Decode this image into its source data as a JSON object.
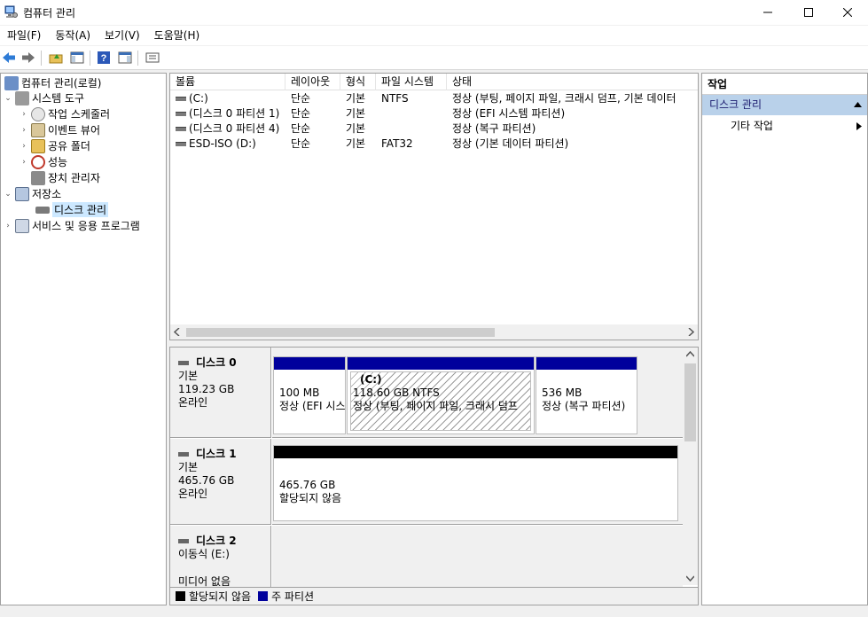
{
  "window": {
    "title": "컴퓨터 관리",
    "minimize": "—",
    "maximize": "☐",
    "close": "✕"
  },
  "menu": [
    "파일(F)",
    "동작(A)",
    "보기(V)",
    "도움말(H)"
  ],
  "tree": {
    "root": "컴퓨터 관리(로컬)",
    "system_tools": "시스템 도구",
    "task_scheduler": "작업 스케줄러",
    "event_viewer": "이벤트 뷰어",
    "shared_folders": "공유 폴더",
    "performance": "성능",
    "device_manager": "장치 관리자",
    "storage": "저장소",
    "disk_management": "디스크 관리",
    "services_apps": "서비스 및 응용 프로그램"
  },
  "volumes": {
    "headers": [
      "볼륨",
      "레이아웃",
      "형식",
      "파일 시스템",
      "상태"
    ],
    "rows": [
      [
        "(C:)",
        "단순",
        "기본",
        "NTFS",
        "정상 (부팅, 페이지 파일, 크래시 덤프, 기본 데이터"
      ],
      [
        "(디스크 0 파티션 1)",
        "단순",
        "기본",
        "",
        "정상 (EFI 시스템 파티션)"
      ],
      [
        "(디스크 0 파티션 4)",
        "단순",
        "기본",
        "",
        "정상 (복구 파티션)"
      ],
      [
        "ESD-ISO (D:)",
        "단순",
        "기본",
        "FAT32",
        "정상 (기본 데이터 파티션)"
      ]
    ]
  },
  "disks": {
    "disk0": {
      "name": "디스크 0",
      "type": "기본",
      "size": "119.23 GB",
      "status": "온라인",
      "p1_size": "100 MB",
      "p1_status": "정상 (EFI 시스",
      "p2_name": "(C:)",
      "p2_size": "118.60 GB NTFS",
      "p2_status": "정상 (부팅, 페이지 파일, 크래시 덤프",
      "p3_size": "536 MB",
      "p3_status": "정상 (복구 파티션)"
    },
    "disk1": {
      "name": "디스크 1",
      "type": "기본",
      "size": "465.76 GB",
      "status": "온라인",
      "p1_size": "465.76 GB",
      "p1_status": "할당되지 않음"
    },
    "disk2": {
      "name": "디스크 2",
      "type": "이동식 (E:)",
      "status": "미디어 없음"
    }
  },
  "legend": {
    "unallocated": "할당되지 않음",
    "primary": "주 파티션"
  },
  "actions": {
    "header": "작업",
    "section": "디스크 관리",
    "more": "기타 작업"
  },
  "colors": {
    "primary_partition": "#00009c",
    "unallocated": "#000000",
    "selection": "#cce8ff",
    "actions_section": "#b9d1ea"
  }
}
